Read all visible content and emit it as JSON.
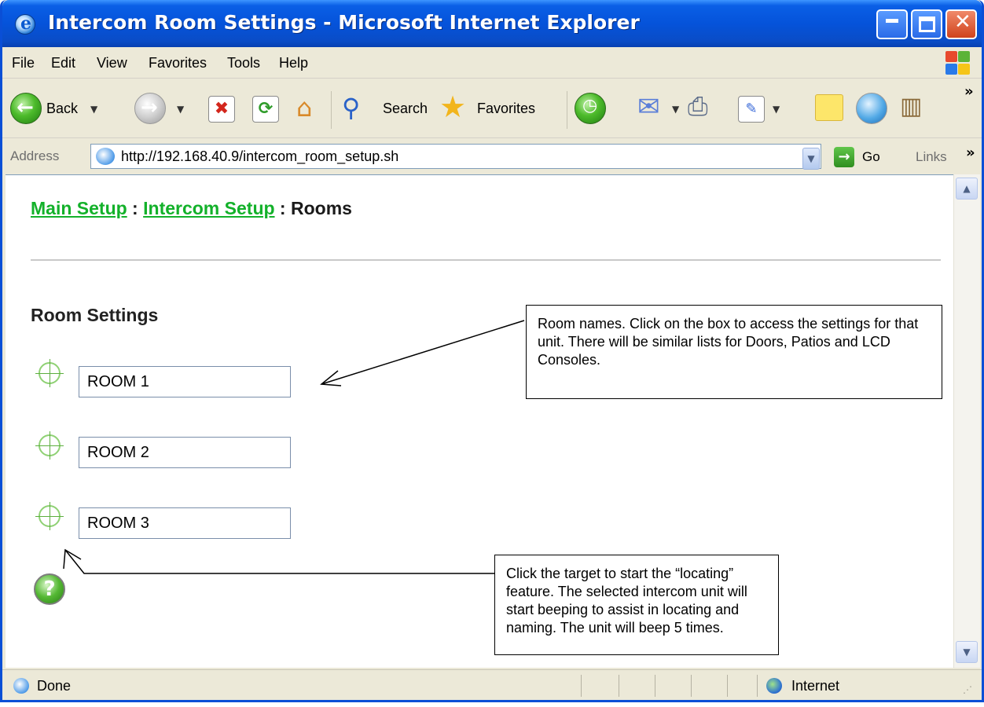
{
  "window": {
    "title": "Intercom Room Settings - Microsoft Internet Explorer",
    "minimize_glyph": "",
    "close_glyph": "✕"
  },
  "menubar": {
    "items": [
      "File",
      "Edit",
      "View",
      "Favorites",
      "Tools",
      "Help"
    ]
  },
  "toolbar": {
    "back_label": "Back",
    "search_label": "Search",
    "favorites_label": "Favorites",
    "overflow_glyph": "»"
  },
  "addressbar": {
    "label": "Address",
    "url": "http://192.168.40.9/intercom_room_setup.sh",
    "go_label": "Go",
    "links_label": "Links",
    "links_overflow": "»"
  },
  "page": {
    "breadcrumb": {
      "main_setup": "Main Setup",
      "sep1": " : ",
      "intercom_setup": "Intercom Setup",
      "sep2": " : ",
      "current": "Rooms"
    },
    "section_title": "Room Settings",
    "rooms": [
      "ROOM 1",
      "ROOM 2",
      "ROOM 3"
    ],
    "help_glyph": "?"
  },
  "callouts": {
    "room_names": "Room names.  Click on the box to access the settings for that unit.  There will be similar lists for Doors, Patios and LCD Consoles.",
    "locating": "Click the target to start the “locating” feature.  The selected intercom unit will start beeping to assist in locating and naming.  The unit will beep 5 times."
  },
  "statusbar": {
    "status": "Done",
    "zone": "Internet"
  },
  "colors": {
    "link_green": "#13b12a",
    "titlebar_blue": "#0553da"
  }
}
